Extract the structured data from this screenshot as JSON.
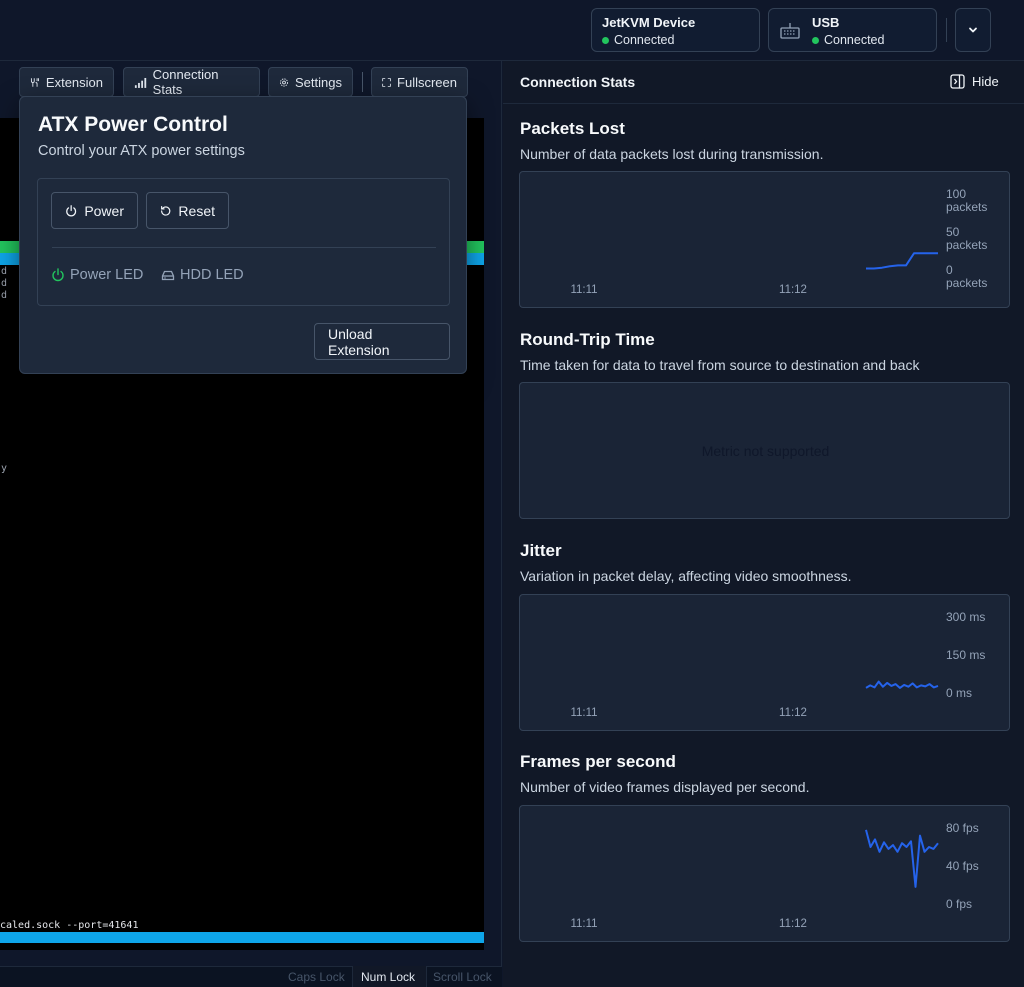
{
  "topbar": {
    "device": {
      "title": "JetKVM Device",
      "status": "Connected"
    },
    "usb": {
      "title": "USB",
      "status": "Connected"
    }
  },
  "toolbar": {
    "extension_label": "Extension",
    "connection_stats_label": "Connection Stats",
    "settings_label": "Settings",
    "fullscreen_label": "Fullscreen"
  },
  "terminal": {
    "lines_d": [
      "d",
      "d",
      "d"
    ],
    "line_y": "y",
    "bottom_line": "caled.sock --port=41641"
  },
  "atx": {
    "title": "ATX Power Control",
    "subtitle": "Control your ATX power settings",
    "power_label": "Power",
    "reset_label": "Reset",
    "power_led_label": "Power LED",
    "hdd_led_label": "HDD LED",
    "unload_label": "Unload Extension"
  },
  "statusbar": {
    "caps": "Caps Lock",
    "num": "Num Lock",
    "scroll": "Scroll Lock"
  },
  "stats": {
    "header": "Connection Stats",
    "hide_label": "Hide",
    "packets_lost": {
      "title": "Packets Lost",
      "desc": "Number of data packets lost during transmission.",
      "y_ticks": [
        "100\npackets",
        "50\npackets",
        "0\npackets"
      ],
      "x_ticks": [
        "11:11",
        "11:12"
      ]
    },
    "rtt": {
      "title": "Round-Trip Time",
      "desc": "Time taken for data to travel from source to destination and back",
      "message": "Metric not supported"
    },
    "jitter": {
      "title": "Jitter",
      "desc": "Variation in packet delay, affecting video smoothness.",
      "y_ticks": [
        "300 ms",
        "150 ms",
        "0 ms"
      ],
      "x_ticks": [
        "11:11",
        "11:12"
      ]
    },
    "fps": {
      "title": "Frames per second",
      "desc": "Number of video frames displayed per second.",
      "y_ticks": [
        "80 fps",
        "40 fps",
        "0 fps"
      ],
      "x_ticks": [
        "11:11",
        "11:12"
      ]
    }
  },
  "chart_data": [
    {
      "type": "line",
      "title": "Packets Lost",
      "ylim": [
        0,
        100
      ],
      "series": [
        {
          "values": [
            2,
            2,
            3,
            5,
            6,
            6,
            22,
            22,
            22,
            22
          ]
        }
      ]
    },
    {
      "type": "line",
      "title": "Jitter",
      "ylim": [
        0,
        300
      ],
      "series": [
        {
          "values": [
            20,
            30,
            22,
            45,
            25,
            40,
            28,
            35,
            20,
            32,
            25,
            38,
            22,
            30,
            26,
            35,
            22,
            28
          ]
        }
      ]
    },
    {
      "type": "line",
      "title": "Frames per second",
      "ylim": [
        0,
        80
      ],
      "series": [
        {
          "values": [
            78,
            60,
            68,
            55,
            65,
            58,
            62,
            55,
            64,
            60,
            66,
            18,
            72,
            55,
            60,
            58,
            64
          ]
        }
      ]
    }
  ],
  "colors": {
    "accent": "#2563eb",
    "ok": "#22c55e",
    "terminal_bar": "#0ea5e9"
  }
}
